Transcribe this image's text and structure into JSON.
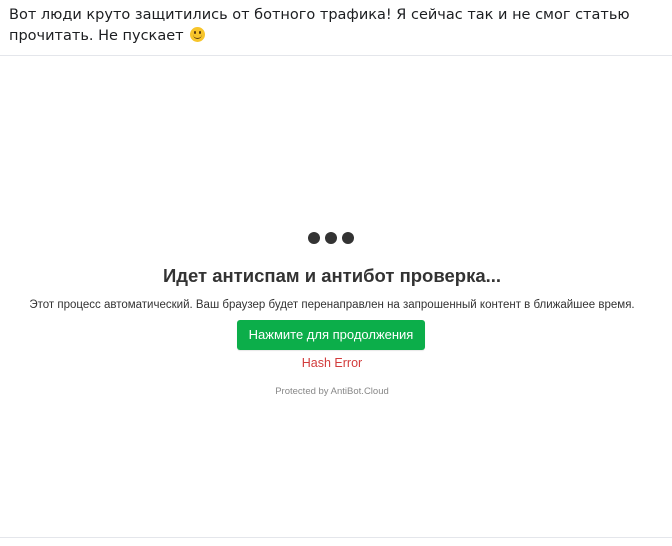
{
  "post": {
    "text": "Вот люди круто защитились от ботного трафика! Я сейчас так и не смог статью прочитать. Не пускает",
    "emoji": "smiling-face"
  },
  "antibot": {
    "title": "Идет антиспам и антибот проверка...",
    "description": "Этот процесс автоматический. Ваш браузер будет перенаправлен на запрошенный контент в ближайшее время.",
    "button_label": "Нажмите для продолжения",
    "error_text": "Hash Error",
    "protected_by": "Protected by AntiBot.Cloud"
  },
  "colors": {
    "button_bg": "#0cae4a",
    "error": "#d23b3b",
    "dots": "#333333"
  }
}
